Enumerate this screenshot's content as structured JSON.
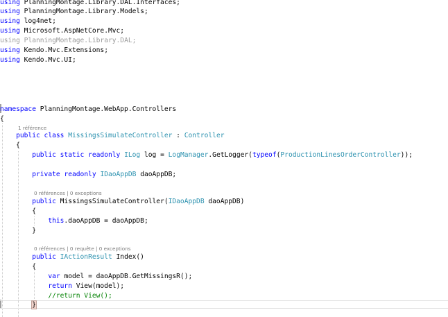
{
  "usings": {
    "line1": "PlanningMontage.Library.DAL.Interfaces;",
    "line2": "PlanningMontage.Library.Models;",
    "line3": "log4net;",
    "line4": "Microsoft.AspNetCore.Mvc;",
    "line5": "PlanningMontage.Library.DAL;",
    "line6": "Kendo.Mvc.Extensions;",
    "line7": "Kendo.Mvc.UI;"
  },
  "keywords": {
    "using": "using",
    "namespace": "namespace",
    "public": "public",
    "class": "class",
    "static": "static",
    "readonly": "readonly",
    "private": "private",
    "typeof": "typeof",
    "this": "this",
    "var": "var",
    "return": "return"
  },
  "code": {
    "namespace_name": "PlanningMontage.WebApp.Controllers",
    "open_brace": "{",
    "close_brace": "}",
    "class_name": "MissingsSimulateController",
    "colon": " : ",
    "base_class": "Controller",
    "ilog_type": "ILog",
    "log_assign": " log = ",
    "logmanager": "LogManager",
    "getlogger": ".GetLogger(",
    "typeof_arg": "ProductionLinesOrderController",
    "getlogger_end": "));",
    "dao_type": "IDaoAppDB",
    "dao_field": " daoAppDB;",
    "ctor_name": "MissingsSimulateController(",
    "ctor_param": " daoAppDB)",
    "ctor_body": ".daoAppDB = daoAppDB;",
    "action_type": "IActionResult",
    "index_sig": " Index()",
    "var_model": " model = daoAppDB.GetMissingsR();",
    "return_view": " View(model);",
    "comment_return": "//return View();"
  },
  "codelens": {
    "class_refs": "1 référence",
    "field_refs": "0 références | 0 exceptions",
    "index_refs": "0 références | 0 requête | 0 exceptions"
  }
}
